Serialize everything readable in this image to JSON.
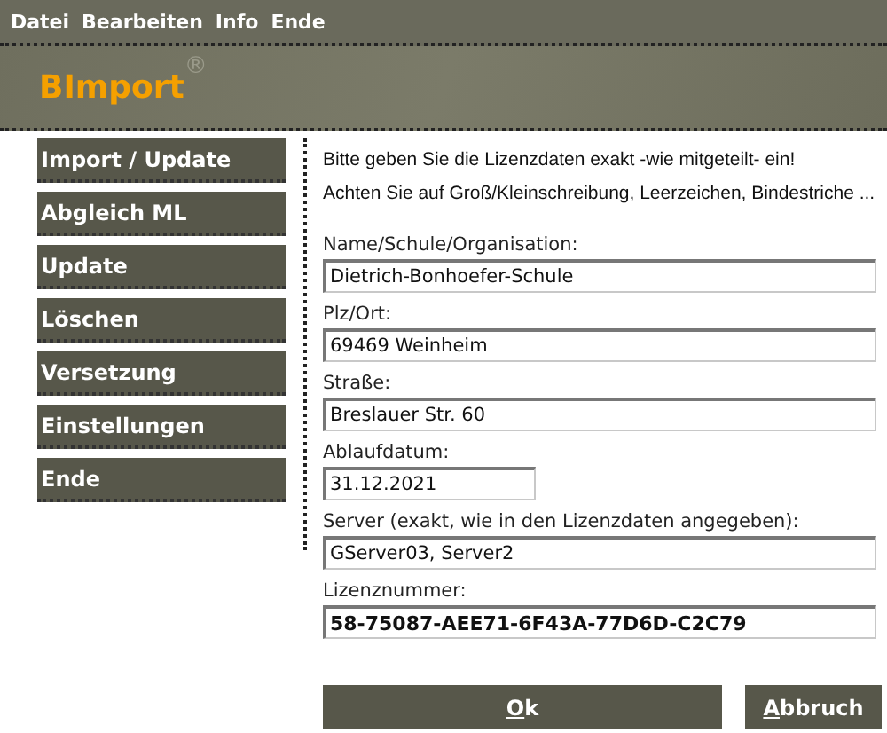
{
  "menu": [
    "Datei",
    "Bearbeiten",
    "Info",
    "Ende"
  ],
  "app_title": {
    "name": "BImport",
    "mark": "®"
  },
  "sidebar": {
    "items": [
      "Import / Update",
      "Abgleich ML",
      "Update",
      "Löschen",
      "Versetzung",
      "Einstellungen",
      "Ende"
    ]
  },
  "intro": [
    "Bitte geben Sie die Lizenzdaten exakt -wie mitgeteilt- ein!",
    "Achten Sie auf Groß/Kleinschreibung, Leerzeichen, Bindestriche ..."
  ],
  "fields": [
    {
      "label": "Name/Schule/Organisation:",
      "value": "Dietrich-Bonhoefer-Schule",
      "kind": "wide"
    },
    {
      "label": "Plz/Ort:",
      "value": "69469 Weinheim",
      "kind": "wide"
    },
    {
      "label": "Straße:",
      "value": "Breslauer Str. 60",
      "kind": "wide"
    },
    {
      "label": "Ablaufdatum:",
      "value": "31.12.2021",
      "kind": "short"
    },
    {
      "label": "Server (exakt, wie in den Lizenzdaten angegeben):",
      "value": "GServer03, Server2",
      "kind": "wide"
    },
    {
      "label": "Lizenznummer:",
      "value": "58-75087-AEE71-6F43A-77D6D-C2C79",
      "kind": "code"
    }
  ],
  "buttons": [
    {
      "label": "Ok",
      "kind": "primary"
    },
    {
      "label": "Abbruch",
      "kind": "secondary"
    }
  ]
}
